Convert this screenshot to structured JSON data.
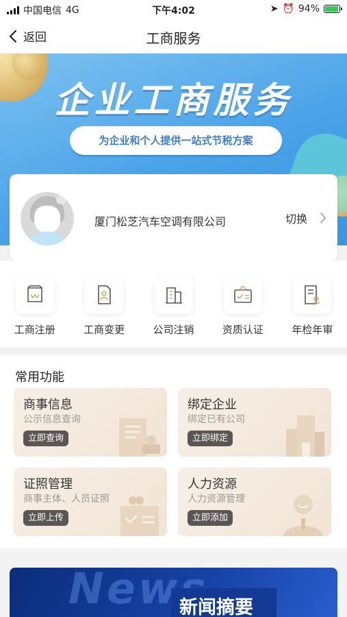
{
  "status_bar": {
    "carrier": "中国电信",
    "network": "4G",
    "time": "下午4:02",
    "battery_pct": "94%",
    "battery_level": 0.94
  },
  "nav": {
    "back_label": "返回",
    "title": "工商服务"
  },
  "banner": {
    "title": "企业工商服务",
    "subtitle": "为企业和个人提供一站式节税方案"
  },
  "company": {
    "name": "厦门松芝汽车空调有限公司",
    "switch_label": "切换"
  },
  "quick_actions": [
    {
      "label": "工商注册",
      "icon": "storefront-icon"
    },
    {
      "label": "工商变更",
      "icon": "document-user-icon"
    },
    {
      "label": "公司注销",
      "icon": "building-icon"
    },
    {
      "label": "资质认证",
      "icon": "certificate-icon"
    },
    {
      "label": "年检年审",
      "icon": "form-stamp-icon"
    }
  ],
  "common_functions": {
    "title": "常用功能",
    "cards": [
      {
        "title": "商事信息",
        "subtitle": "公示信息查询",
        "button": "立即查询",
        "icon": "document-stamp-icon"
      },
      {
        "title": "绑定企业",
        "subtitle": "绑定已有公司",
        "button": "立即绑定",
        "icon": "building-icon"
      },
      {
        "title": "证照管理",
        "subtitle": "商事主体、人员证照",
        "button": "立即上传",
        "icon": "license-icon"
      },
      {
        "title": "人力资源",
        "subtitle": "人力资源管理",
        "button": "立即添加",
        "icon": "person-tie-icon"
      }
    ]
  },
  "news": {
    "label": "新闻摘要",
    "background_word": "News"
  },
  "colors": {
    "banner_blue": "#4aa3e8",
    "pill_text": "#3d7fc9",
    "card_bg": "#f3e8dc",
    "button_dark": "#5b5554",
    "news_blue": "#1844a8"
  }
}
